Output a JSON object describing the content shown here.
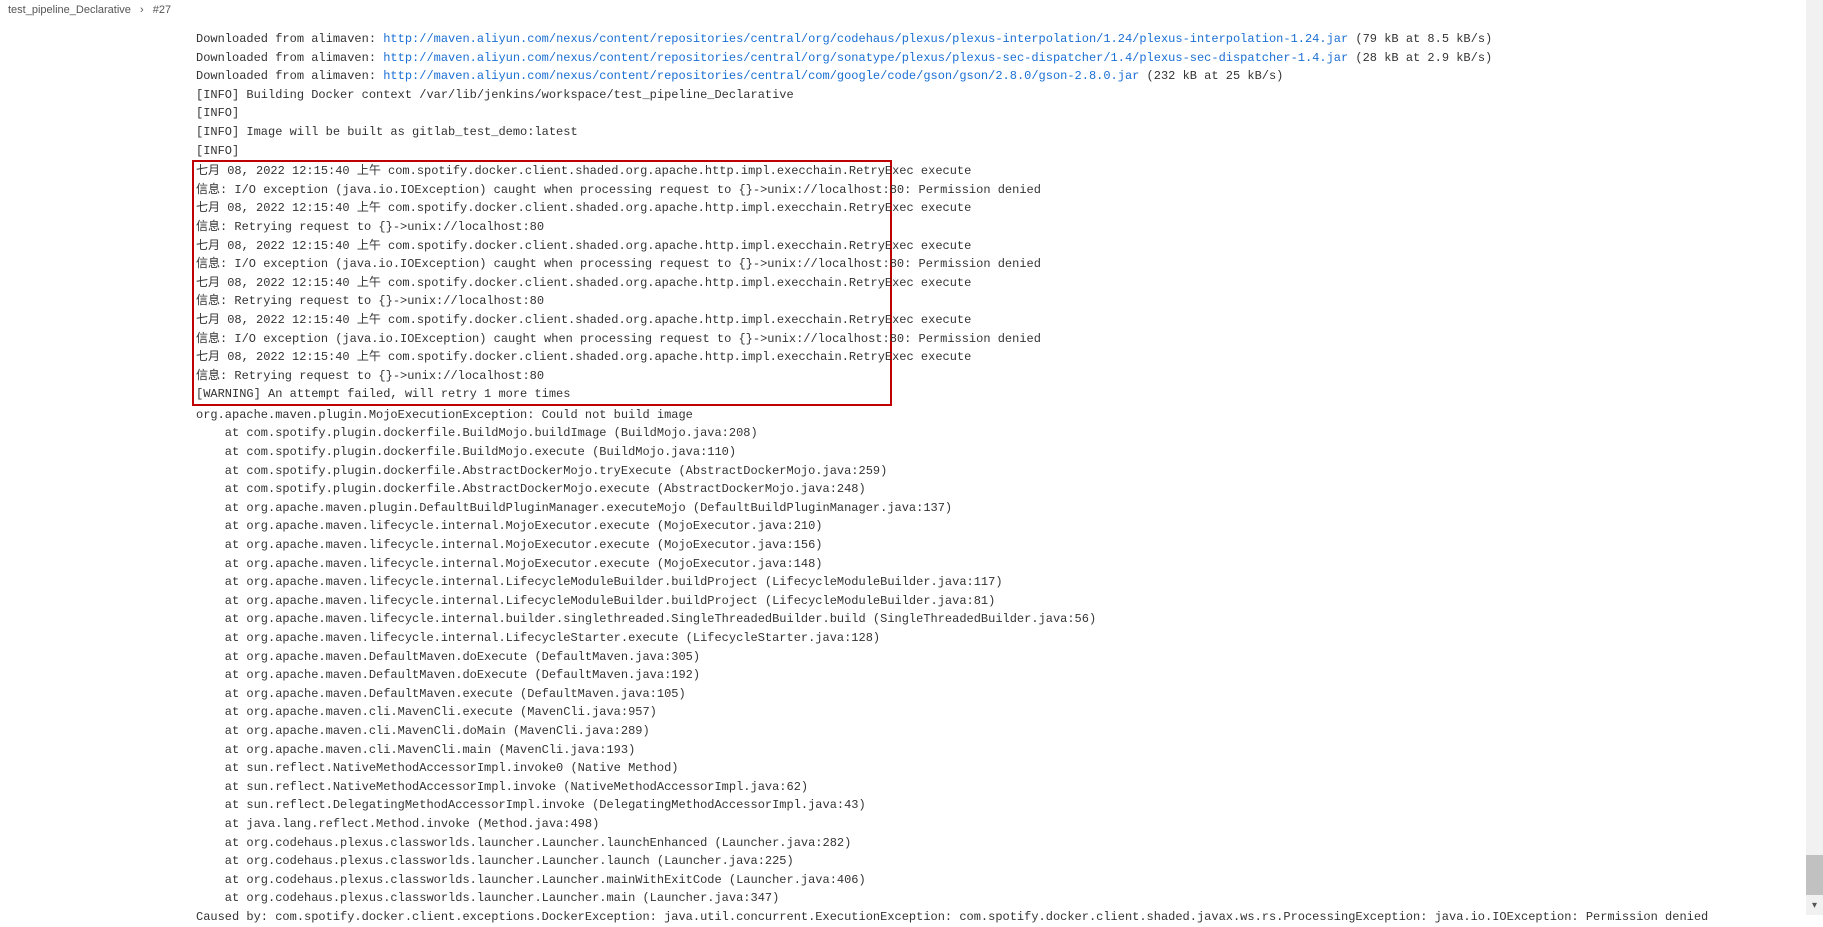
{
  "breadcrumb": {
    "item1": "test_pipeline_Declarative",
    "sep": "›",
    "item2": "#27"
  },
  "downloads": [
    {
      "prefix": "Downloaded from alimaven: ",
      "url": "http://maven.aliyun.com/nexus/content/repositories/central/org/codehaus/plexus/plexus-interpolation/1.24/plexus-interpolation-1.24.jar",
      "suffix": " (79 kB at 8.5 kB/s)"
    },
    {
      "prefix": "Downloaded from alimaven: ",
      "url": "http://maven.aliyun.com/nexus/content/repositories/central/org/sonatype/plexus/plexus-sec-dispatcher/1.4/plexus-sec-dispatcher-1.4.jar",
      "suffix": " (28 kB at 2.9 kB/s)"
    },
    {
      "prefix": "Downloaded from alimaven: ",
      "url": "http://maven.aliyun.com/nexus/content/repositories/central/com/google/code/gson/gson/2.8.0/gson-2.8.0.jar",
      "suffix": " (232 kB at 25 kB/s)"
    }
  ],
  "info_lines": [
    "[INFO] Building Docker context /var/lib/jenkins/workspace/test_pipeline_Declarative",
    "[INFO] ",
    "[INFO] Image will be built as gitlab_test_demo:latest",
    "[INFO] "
  ],
  "boxed_lines": [
    "七月 08, 2022 12:15:40 上午 com.spotify.docker.client.shaded.org.apache.http.impl.execchain.RetryExec execute",
    "信息: I/O exception (java.io.IOException) caught when processing request to {}->unix://localhost:80: Permission denied",
    "七月 08, 2022 12:15:40 上午 com.spotify.docker.client.shaded.org.apache.http.impl.execchain.RetryExec execute",
    "信息: Retrying request to {}->unix://localhost:80",
    "七月 08, 2022 12:15:40 上午 com.spotify.docker.client.shaded.org.apache.http.impl.execchain.RetryExec execute",
    "信息: I/O exception (java.io.IOException) caught when processing request to {}->unix://localhost:80: Permission denied",
    "七月 08, 2022 12:15:40 上午 com.spotify.docker.client.shaded.org.apache.http.impl.execchain.RetryExec execute",
    "信息: Retrying request to {}->unix://localhost:80",
    "七月 08, 2022 12:15:40 上午 com.spotify.docker.client.shaded.org.apache.http.impl.execchain.RetryExec execute",
    "信息: I/O exception (java.io.IOException) caught when processing request to {}->unix://localhost:80: Permission denied",
    "七月 08, 2022 12:15:40 上午 com.spotify.docker.client.shaded.org.apache.http.impl.execchain.RetryExec execute",
    "信息: Retrying request to {}->unix://localhost:80",
    "[WARNING] An attempt failed, will retry 1 more times"
  ],
  "exception_header": "org.apache.maven.plugin.MojoExecutionException: Could not build image",
  "stack_lines": [
    "    at com.spotify.plugin.dockerfile.BuildMojo.buildImage (BuildMojo.java:208)",
    "    at com.spotify.plugin.dockerfile.BuildMojo.execute (BuildMojo.java:110)",
    "    at com.spotify.plugin.dockerfile.AbstractDockerMojo.tryExecute (AbstractDockerMojo.java:259)",
    "    at com.spotify.plugin.dockerfile.AbstractDockerMojo.execute (AbstractDockerMojo.java:248)",
    "    at org.apache.maven.plugin.DefaultBuildPluginManager.executeMojo (DefaultBuildPluginManager.java:137)",
    "    at org.apache.maven.lifecycle.internal.MojoExecutor.execute (MojoExecutor.java:210)",
    "    at org.apache.maven.lifecycle.internal.MojoExecutor.execute (MojoExecutor.java:156)",
    "    at org.apache.maven.lifecycle.internal.MojoExecutor.execute (MojoExecutor.java:148)",
    "    at org.apache.maven.lifecycle.internal.LifecycleModuleBuilder.buildProject (LifecycleModuleBuilder.java:117)",
    "    at org.apache.maven.lifecycle.internal.LifecycleModuleBuilder.buildProject (LifecycleModuleBuilder.java:81)",
    "    at org.apache.maven.lifecycle.internal.builder.singlethreaded.SingleThreadedBuilder.build (SingleThreadedBuilder.java:56)",
    "    at org.apache.maven.lifecycle.internal.LifecycleStarter.execute (LifecycleStarter.java:128)",
    "    at org.apache.maven.DefaultMaven.doExecute (DefaultMaven.java:305)",
    "    at org.apache.maven.DefaultMaven.doExecute (DefaultMaven.java:192)",
    "    at org.apache.maven.DefaultMaven.execute (DefaultMaven.java:105)",
    "    at org.apache.maven.cli.MavenCli.execute (MavenCli.java:957)",
    "    at org.apache.maven.cli.MavenCli.doMain (MavenCli.java:289)",
    "    at org.apache.maven.cli.MavenCli.main (MavenCli.java:193)",
    "    at sun.reflect.NativeMethodAccessorImpl.invoke0 (Native Method)",
    "    at sun.reflect.NativeMethodAccessorImpl.invoke (NativeMethodAccessorImpl.java:62)",
    "    at sun.reflect.DelegatingMethodAccessorImpl.invoke (DelegatingMethodAccessorImpl.java:43)",
    "    at java.lang.reflect.Method.invoke (Method.java:498)",
    "    at org.codehaus.plexus.classworlds.launcher.Launcher.launchEnhanced (Launcher.java:282)",
    "    at org.codehaus.plexus.classworlds.launcher.Launcher.launch (Launcher.java:225)",
    "    at org.codehaus.plexus.classworlds.launcher.Launcher.mainWithExitCode (Launcher.java:406)",
    "    at org.codehaus.plexus.classworlds.launcher.Launcher.main (Launcher.java:347)"
  ],
  "caused_by": "Caused by: com.spotify.docker.client.exceptions.DockerException: java.util.concurrent.ExecutionException: com.spotify.docker.client.shaded.javax.ws.rs.ProcessingException: java.io.IOException: Permission denied"
}
